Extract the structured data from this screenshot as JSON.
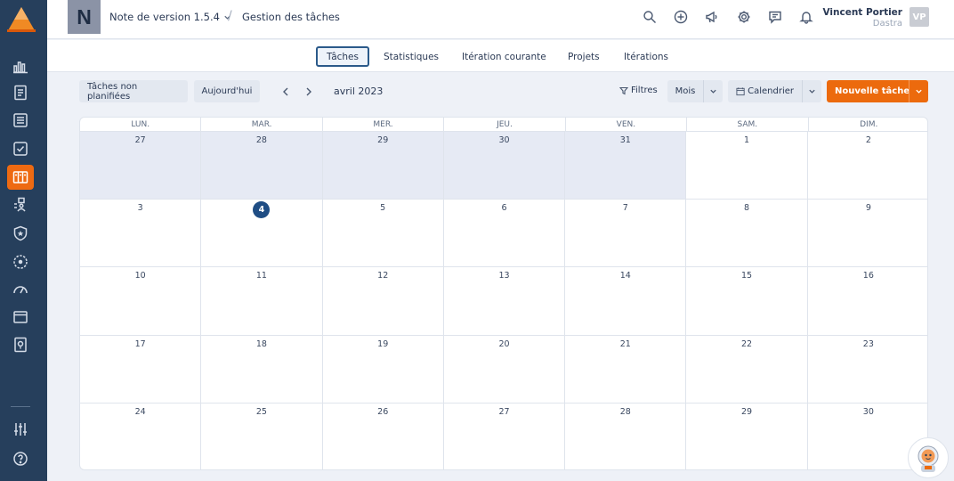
{
  "header": {
    "project_initial": "N",
    "project_name": "Note de version 1.5.4",
    "breadcrumb_separator": "/",
    "page_title": "Gestion des tâches",
    "user_name": "Vincent Portier",
    "user_org": "Dastra",
    "user_initials": "VP",
    "icons": [
      "search-icon",
      "plus-circle-icon",
      "megaphone-icon",
      "gear-icon",
      "chat-icon",
      "bell-icon"
    ]
  },
  "sidebar": {
    "icons": [
      "dashboard-chart-icon",
      "document-icon",
      "register-list-icon",
      "checklist-icon",
      "tasks-board-icon",
      "organisation-icon",
      "shield-icon",
      "compass-icon",
      "gauge-icon",
      "folder-icon",
      "help-doc-icon",
      "settings-sliders-icon",
      "help-circle-icon"
    ],
    "active": "tasks-board-icon"
  },
  "tabs": [
    {
      "label": "Tâches",
      "active": true
    },
    {
      "label": "Statistiques",
      "active": false
    },
    {
      "label": "Itération courante",
      "active": false
    },
    {
      "label": "Projets",
      "active": false
    },
    {
      "label": "Itérations",
      "active": false
    }
  ],
  "toolbar": {
    "unplanned_label": "Tâches non planifiées",
    "today_label": "Aujourd'hui",
    "month_label": "avril 2023",
    "filters_label": "Filtres",
    "view_label": "Mois",
    "mode_label": "Calendrier",
    "new_task_label": "Nouvelle tâche"
  },
  "calendar": {
    "weekdays": [
      "LUN.",
      "MAR.",
      "MER.",
      "JEU.",
      "VEN.",
      "SAM.",
      "DIM."
    ],
    "weeks": [
      [
        {
          "d": "27",
          "out": true
        },
        {
          "d": "28",
          "out": true
        },
        {
          "d": "29",
          "out": true
        },
        {
          "d": "30",
          "out": true
        },
        {
          "d": "31",
          "out": true
        },
        {
          "d": "1"
        },
        {
          "d": "2"
        }
      ],
      [
        {
          "d": "3"
        },
        {
          "d": "4",
          "today": true
        },
        {
          "d": "5"
        },
        {
          "d": "6"
        },
        {
          "d": "7"
        },
        {
          "d": "8"
        },
        {
          "d": "9"
        }
      ],
      [
        {
          "d": "10"
        },
        {
          "d": "11"
        },
        {
          "d": "12"
        },
        {
          "d": "13"
        },
        {
          "d": "14"
        },
        {
          "d": "15"
        },
        {
          "d": "16"
        }
      ],
      [
        {
          "d": "17"
        },
        {
          "d": "18"
        },
        {
          "d": "19"
        },
        {
          "d": "20"
        },
        {
          "d": "21"
        },
        {
          "d": "22"
        },
        {
          "d": "23"
        }
      ],
      [
        {
          "d": "24"
        },
        {
          "d": "25"
        },
        {
          "d": "26"
        },
        {
          "d": "27"
        },
        {
          "d": "28"
        },
        {
          "d": "29"
        },
        {
          "d": "30"
        }
      ]
    ]
  },
  "colors": {
    "sidebar": "#263f5c",
    "accent": "#ec6a0d",
    "today": "#1f4d84",
    "out_of_month": "#e6eaf4"
  }
}
